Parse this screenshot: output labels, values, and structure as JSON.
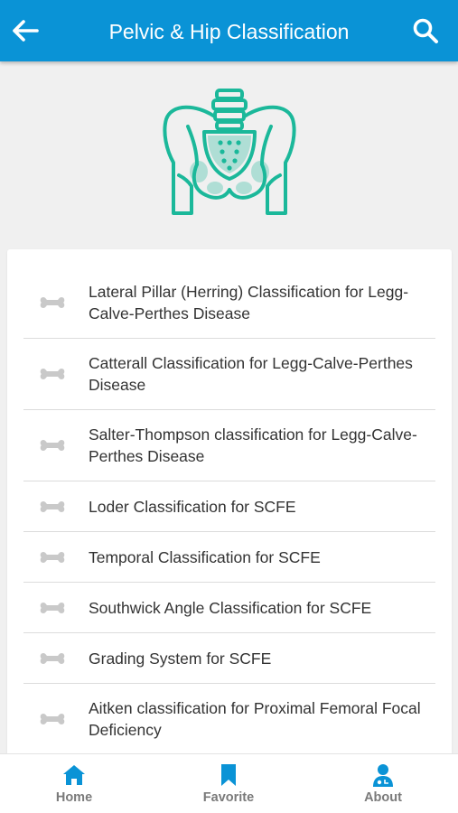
{
  "header": {
    "title": "Pelvic & Hip Classification",
    "back_icon": "arrow-left-icon",
    "search_icon": "search-icon",
    "bar_color": "#0a93d6"
  },
  "hero": {
    "icon": "pelvis-icon",
    "icon_color": "#1bb89a"
  },
  "list": {
    "item_icon": "bone-icon",
    "items": [
      {
        "label": "Lateral Pillar (Herring) Classification for Legg-Calve-Perthes Disease"
      },
      {
        "label": "Catterall Classification for Legg-Calve-Perthes Disease"
      },
      {
        "label": "Salter-Thompson classification for Legg-Calve-Perthes Disease"
      },
      {
        "label": "Loder Classification for SCFE"
      },
      {
        "label": "Temporal Classification for SCFE"
      },
      {
        "label": "Southwick Angle Classification for SCFE"
      },
      {
        "label": "Grading System for SCFE"
      },
      {
        "label": "Aitken classification for Proximal Femoral Focal Deficiency"
      }
    ]
  },
  "bottom_nav": {
    "active_color": "#0a93d6",
    "items": [
      {
        "label": "Home",
        "icon": "home-icon"
      },
      {
        "label": "Favorite",
        "icon": "bookmark-icon"
      },
      {
        "label": "About",
        "icon": "doctor-icon"
      }
    ]
  }
}
